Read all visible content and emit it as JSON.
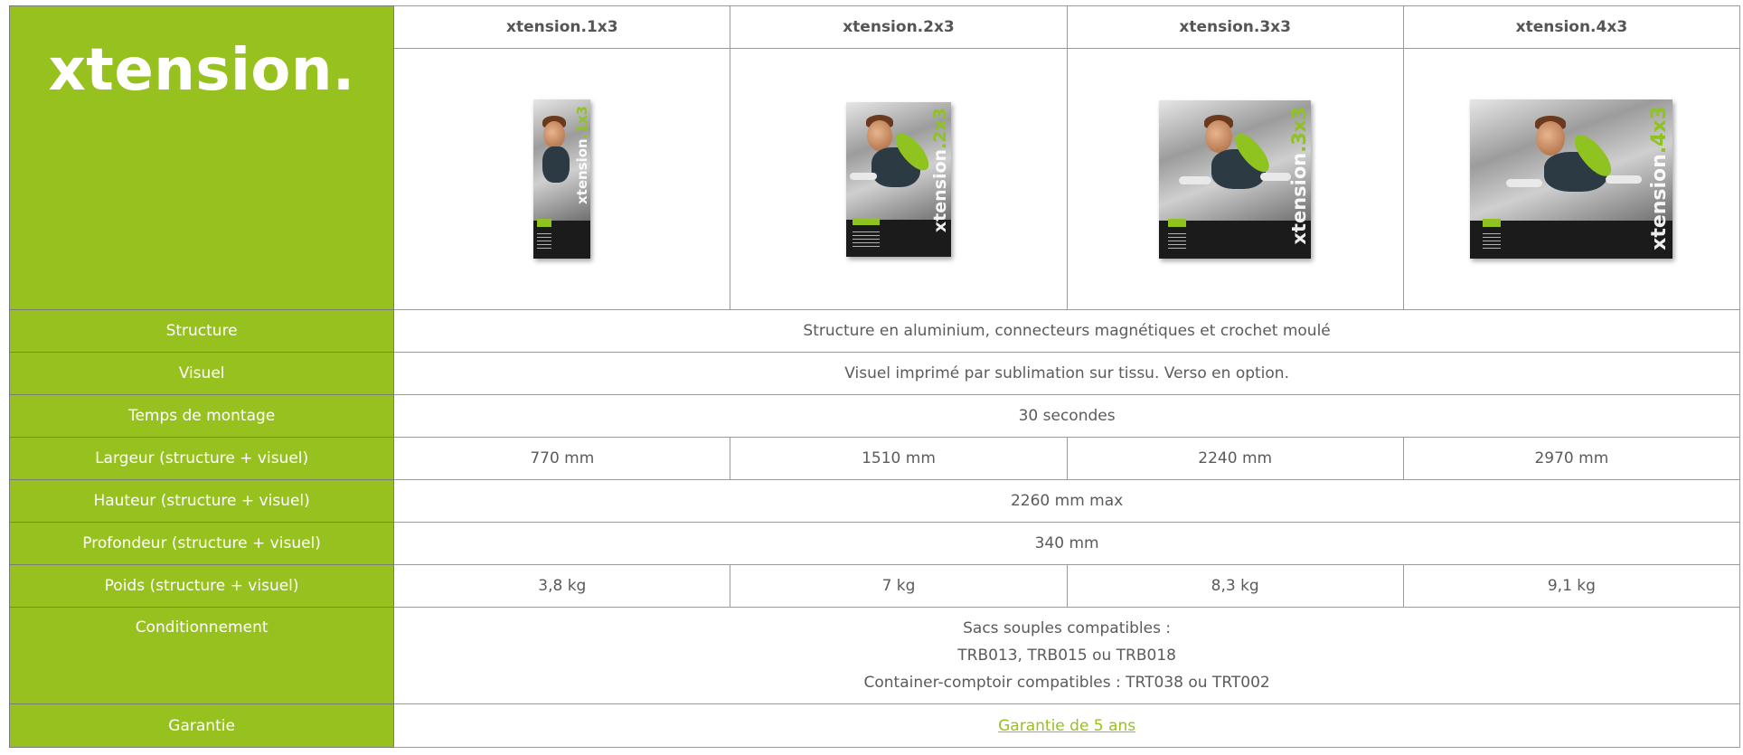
{
  "brand": {
    "logo_text": "xtension."
  },
  "colors": {
    "accent_green": "#97c11f",
    "text_gray": "#5b5b5b",
    "border": "#9a9a9a"
  },
  "products": [
    {
      "name": "xtension.1x3",
      "image_label_a": "xtension",
      "image_label_b": ".1x3"
    },
    {
      "name": "xtension.2x3",
      "image_label_a": "xtension",
      "image_label_b": ".2x3"
    },
    {
      "name": "xtension.3x3",
      "image_label_a": "xtension",
      "image_label_b": ".3x3"
    },
    {
      "name": "xtension.4x3",
      "image_label_a": "xtension",
      "image_label_b": ".4x3"
    }
  ],
  "rows": {
    "structure": {
      "label": "Structure",
      "value": "Structure en aluminium, connecteurs magnétiques et crochet moulé"
    },
    "visuel": {
      "label": "Visuel",
      "value": "Visuel imprimé par sublimation sur tissu. Verso en option."
    },
    "temps": {
      "label": "Temps de montage",
      "value": "30 secondes"
    },
    "largeur": {
      "label": "Largeur (structure + visuel)",
      "values": [
        "770 mm",
        "1510 mm",
        "2240 mm",
        "2970 mm"
      ]
    },
    "hauteur": {
      "label": "Hauteur (structure + visuel)",
      "value": "2260 mm max"
    },
    "profondeur": {
      "label": "Profondeur (structure + visuel)",
      "value": "340 mm"
    },
    "poids": {
      "label": "Poids (structure + visuel)",
      "values": [
        "3,8 kg",
        "7 kg",
        "8,3 kg",
        "9,1 kg"
      ]
    },
    "conditionnement": {
      "label": "Conditionnement",
      "lines": [
        "Sacs souples compatibles :",
        "TRB013, TRB015 ou TRB018",
        "Container-comptoir compatibles : TRT038 ou TRT002"
      ]
    },
    "garantie": {
      "label": "Garantie",
      "link_text": "Garantie de 5 ans"
    }
  }
}
